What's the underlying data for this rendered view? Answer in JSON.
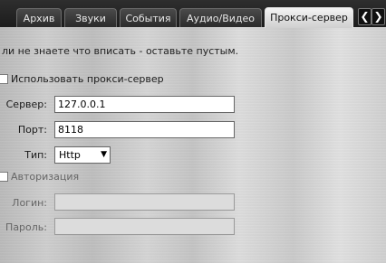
{
  "tabs": [
    {
      "label": "Архив",
      "active": false
    },
    {
      "label": "Звуки",
      "active": false
    },
    {
      "label": "События",
      "active": false
    },
    {
      "label": "Аудио/Видео",
      "active": false
    },
    {
      "label": "Прокси-сервер",
      "active": true
    }
  ],
  "tab_scroll": {
    "left_icon": "chevron-left-icon",
    "right_icon": "chevron-right-icon"
  },
  "hint": "ли не знаете что вписать - оставьте пустым.",
  "proxy": {
    "checkbox_label": "Использовать прокси-сервер",
    "server_label": "Сервер:",
    "server_value": "127.0.0.1",
    "port_label": "Порт:",
    "port_value": "8118",
    "type_label": "Тип:",
    "type_value": "Http"
  },
  "auth": {
    "checkbox_label": "Авторизация",
    "login_label": "Логин:",
    "login_value": "",
    "password_label": "Пароль:",
    "password_value": ""
  }
}
